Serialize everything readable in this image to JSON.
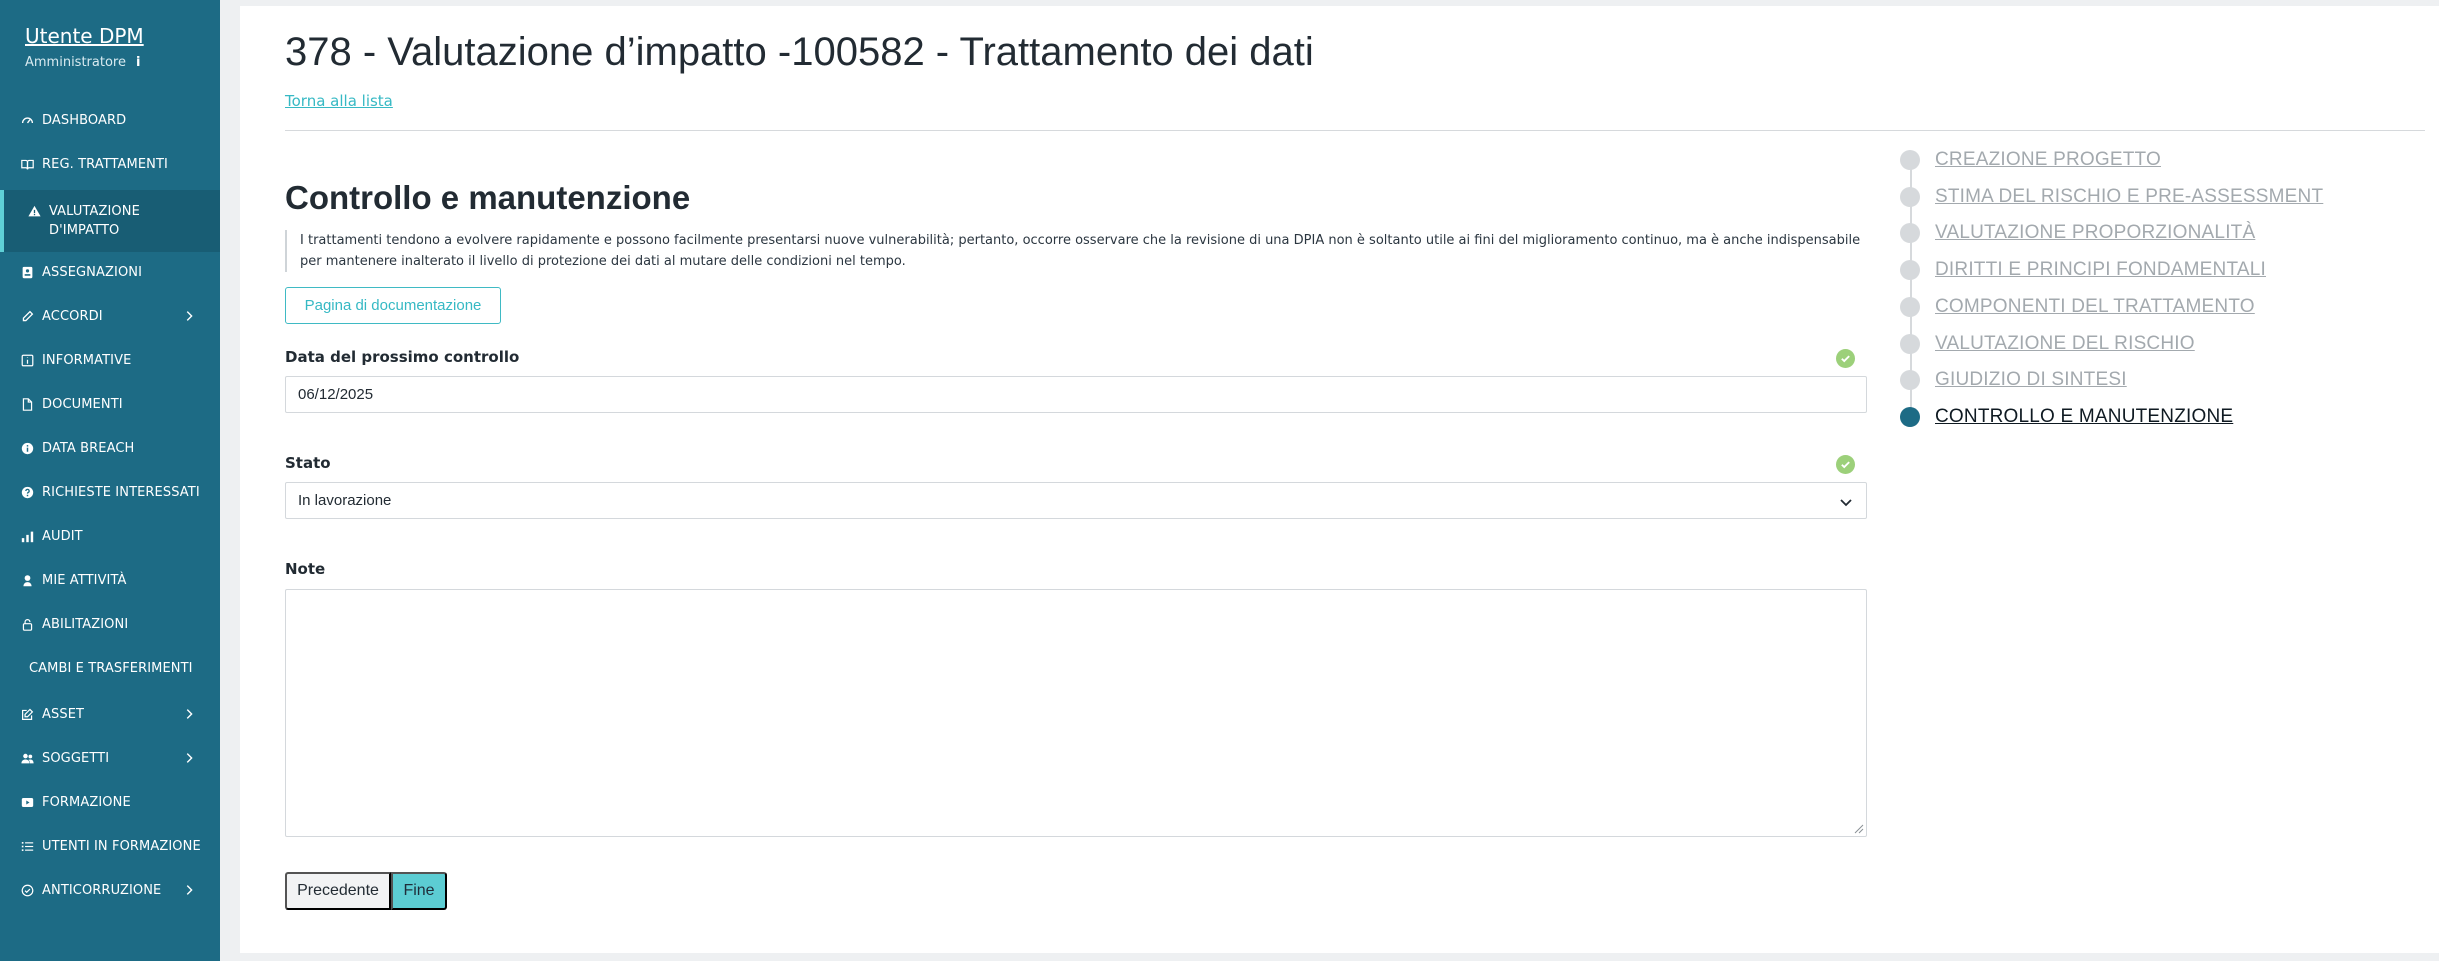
{
  "sidebar": {
    "user_name": "Utente DPM",
    "user_role": "Amministratore",
    "info_glyph": "i",
    "items": [
      {
        "label": "DASHBOARD",
        "icon": "gauge-icon"
      },
      {
        "label": "REG. TRATTAMENTI",
        "icon": "book-icon"
      },
      {
        "label": "VALUTAZIONE D'IMPATTO",
        "icon": "warning-icon",
        "active": true
      },
      {
        "label": "ASSEGNAZIONI",
        "icon": "id-badge-icon"
      },
      {
        "label": "ACCORDI",
        "icon": "pen-icon",
        "expandable": true
      },
      {
        "label": "INFORMATIVE",
        "icon": "info-square-icon"
      },
      {
        "label": "DOCUMENTI",
        "icon": "file-icon"
      },
      {
        "label": "DATA BREACH",
        "icon": "info-circle-icon"
      },
      {
        "label": "RICHIESTE INTERESSATI",
        "icon": "question-circle-icon"
      },
      {
        "label": "AUDIT",
        "icon": "bar-chart-icon"
      },
      {
        "label": "MIE ATTIVITÀ",
        "icon": "user-pin-icon"
      },
      {
        "label": "ABILITAZIONI",
        "icon": "lock-icon"
      },
      {
        "label": "CAMBI E TRASFERIMENTI",
        "icon": ""
      },
      {
        "label": "ASSET",
        "icon": "edit-icon",
        "expandable": true
      },
      {
        "label": "SOGGETTI",
        "icon": "users-icon",
        "expandable": true
      },
      {
        "label": "FORMAZIONE",
        "icon": "video-icon"
      },
      {
        "label": "UTENTI IN FORMAZIONE",
        "icon": "list-icon"
      },
      {
        "label": "ANTICORRUZIONE",
        "icon": "check-circle-icon",
        "expandable": true
      }
    ]
  },
  "header": {
    "title": "378 - Valutazione d’impatto -100582 - Trattamento dei dati",
    "back_link": "Torna alla lista"
  },
  "section": {
    "title": "Controllo e manutenzione",
    "description": "I trattamenti tendono a evolvere rapidamente e possono facilmente presentarsi nuove vulnerabilità; pertanto, occorre osservare che la revisione di una DPIA non è soltanto utile ai fini del miglioramento continuo, ma è anche indispensabile per mantenere inalterato il livello di protezione dei dati al mutare delle condizioni nel tempo.",
    "doc_button": "Pagina di documentazione"
  },
  "form": {
    "next_check": {
      "label": "Data del prossimo controllo",
      "value": "06/12/2025"
    },
    "status": {
      "label": "Stato",
      "value": "In lavorazione"
    },
    "notes": {
      "label": "Note",
      "value": ""
    }
  },
  "actions": {
    "prev": "Precedente",
    "finish": "Fine"
  },
  "steps": [
    {
      "label": "CREAZIONE PROGETTO"
    },
    {
      "label": "STIMA DEL RISCHIO E PRE-ASSESSMENT"
    },
    {
      "label": "VALUTAZIONE PROPORZIONALITÀ"
    },
    {
      "label": "DIRITTI E PRINCIPI FONDAMENTALI"
    },
    {
      "label": "COMPONENTI DEL TRATTAMENTO"
    },
    {
      "label": "VALUTAZIONE DEL RISCHIO"
    },
    {
      "label": "GIUDIZIO DI SINTESI"
    },
    {
      "label": "CONTROLLO E MANUTENZIONE",
      "current": true
    }
  ],
  "colors": {
    "sidebar": "#1d6b85",
    "accent": "#5ccdd3",
    "link": "#36b9c4",
    "check": "#9cd07a"
  }
}
